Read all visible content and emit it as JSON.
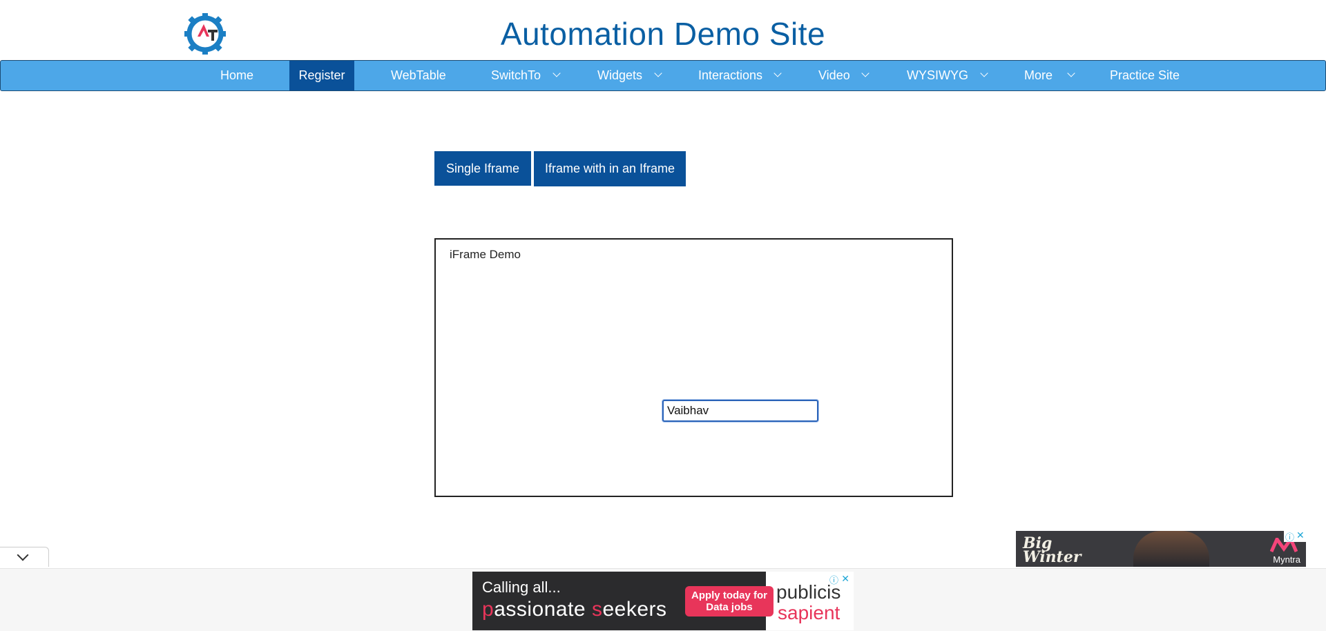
{
  "header": {
    "title": "Automation Demo Site"
  },
  "nav": {
    "items": [
      {
        "label": "Home",
        "dropdown": false
      },
      {
        "label": "Register",
        "dropdown": false,
        "active": true
      },
      {
        "label": "WebTable",
        "dropdown": false
      },
      {
        "label": "SwitchTo",
        "dropdown": true
      },
      {
        "label": "Widgets",
        "dropdown": true
      },
      {
        "label": "Interactions",
        "dropdown": true
      },
      {
        "label": "Video",
        "dropdown": true
      },
      {
        "label": "WYSIWYG",
        "dropdown": true
      },
      {
        "label": "More",
        "dropdown": true
      },
      {
        "label": "Practice Site",
        "dropdown": false
      }
    ]
  },
  "tabs": {
    "single": "Single Iframe",
    "nested": "Iframe with in an Iframe"
  },
  "iframe": {
    "title": "iFrame Demo",
    "input_value": "Vaibhav"
  },
  "ads": {
    "right": {
      "line1": "Big",
      "line2": "Winter",
      "brand": "Myntra"
    },
    "bottom": {
      "line1": "Calling all...",
      "line2a": "p",
      "line2b": "assionate ",
      "line2c": "s",
      "line2d": "eekers",
      "cta": "Apply today for Data jobs",
      "brand1": "publicis",
      "brand2": "sapient"
    }
  },
  "colors": {
    "brand": "#0a5fa3",
    "nav": "#4da7e8",
    "active": "#0a5199",
    "ad_accent": "#e8355a"
  }
}
